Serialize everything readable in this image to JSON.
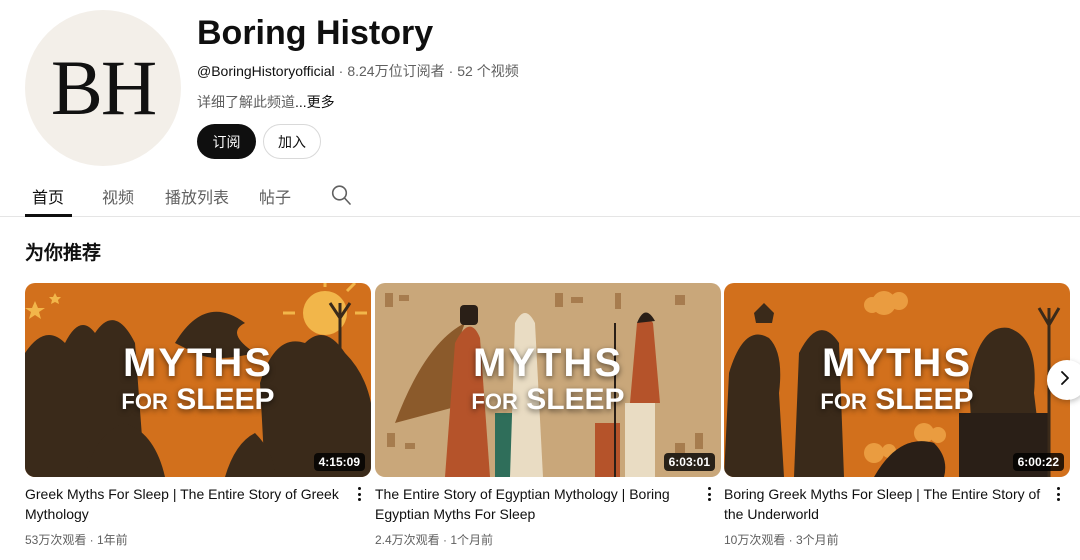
{
  "channel": {
    "avatar_text": "BH",
    "name": "Boring History",
    "handle": "@BoringHistoryofficial",
    "subscribers": "8.24万位订阅者",
    "video_count": "52 个视频",
    "description": "详细了解此频道",
    "more_label": "...更多",
    "subscribe_label": "订阅",
    "join_label": "加入"
  },
  "tabs": [
    {
      "label": "首页",
      "active": true
    },
    {
      "label": "视频",
      "active": false
    },
    {
      "label": "播放列表",
      "active": false
    },
    {
      "label": "帖子",
      "active": false
    }
  ],
  "section": {
    "title": "为你推荐"
  },
  "videos": [
    {
      "thumb_line1": "MYTHS",
      "thumb_for": "FOR",
      "thumb_line2": "SLEEP",
      "duration": "4:15:09",
      "title": "Greek Myths For Sleep | The Entire Story of Greek Mythology",
      "stats": "53万次观看 · 1年前"
    },
    {
      "thumb_line1": "MYTHS",
      "thumb_for": "FOR",
      "thumb_line2": "SLEEP",
      "duration": "6:03:01",
      "title": "The Entire Story of Egyptian Mythology | Boring Egyptian Myths For Sleep",
      "stats": "2.4万次观看 · 1个月前"
    },
    {
      "thumb_line1": "MYTHS",
      "thumb_for": "FOR",
      "thumb_line2": "SLEEP",
      "duration": "6:00:22",
      "title": "Boring Greek Myths For Sleep | The Entire Story of the Underworld",
      "stats": "10万次观看 · 3个月前"
    }
  ],
  "icons": {
    "search": "search-icon",
    "more": "more-vert-icon",
    "next": "chevron-right-icon"
  },
  "colors": {
    "thumb_orange": "#d2701c",
    "thumb_dark": "#3a2a1a",
    "egypt_bg": "#c9a77a"
  }
}
